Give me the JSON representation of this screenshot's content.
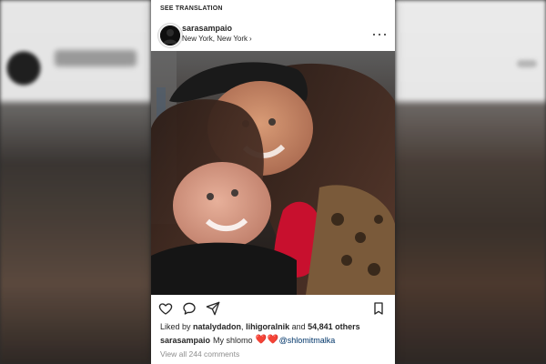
{
  "post": {
    "see_translation": "SEE TRANSLATION",
    "header": {
      "username": "sarasampaio",
      "location": "New York, New York",
      "location_chevron": "›"
    },
    "icons": {
      "avatar": "avatar-icon",
      "more": "more-options-icon",
      "like": "heart-outline-icon",
      "comment": "comment-bubble-icon",
      "share": "paper-plane-icon",
      "save": "bookmark-icon"
    },
    "likes": {
      "prefix": "Liked by ",
      "user1": "natalydadon",
      "sep": ", ",
      "user2": "lihigoralnik",
      "and": " and ",
      "count": "54,841 others"
    },
    "caption": {
      "username": "sarasampaio",
      "text": "My shlomo",
      "emoji_1": "❤️",
      "emoji_2": "❤️",
      "mention": "@shlomitmalka"
    },
    "view_comments": "View all 244 comments"
  },
  "colors": {
    "text": "#262626",
    "muted": "#8e8e8e",
    "mention": "#003569",
    "heart": "#ed4956"
  }
}
